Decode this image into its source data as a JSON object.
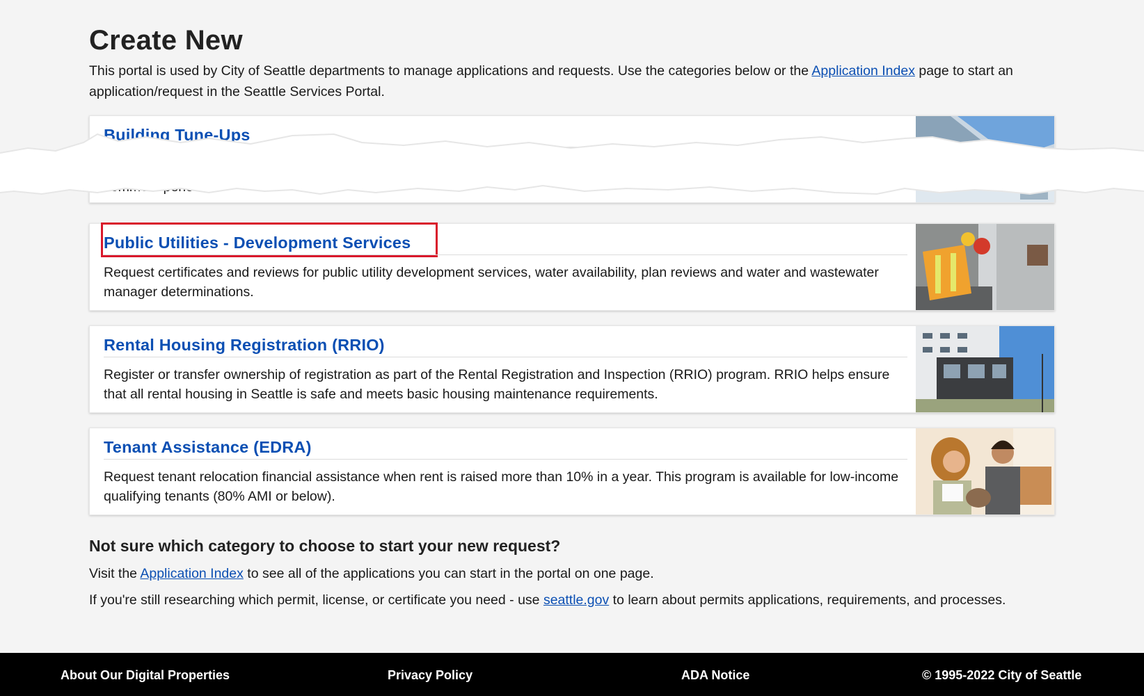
{
  "page": {
    "title": "Create New",
    "intro_before": "This portal is used by City of Seattle departments to manage applications and requests. Use the categories below or the ",
    "intro_link": "Application Index",
    "intro_after": " page to start an application/request in the Seattle Services Portal."
  },
  "cards": [
    {
      "title": "Building Tune-Ups",
      "description_partial": "Com",
      "description_end": "comment period.",
      "image_icon": "building-photo"
    },
    {
      "title": "Public Utilities - Development Services",
      "description": "Request certificates and reviews for public utility development services, water availability, plan reviews and water and wastewater manager determinations.",
      "image_icon": "utility-workers-photo",
      "highlighted": true,
      "highlight_color": "#d9182b"
    },
    {
      "title": "Rental Housing Registration (RRIO)",
      "description": "Register or transfer ownership of registration as part of the Rental Registration and Inspection (RRIO) program. RRIO helps ensure that all rental housing in Seattle is safe and meets basic housing maintenance requirements.",
      "image_icon": "apartment-building-photo"
    },
    {
      "title": "Tenant Assistance (EDRA)",
      "description": "Request tenant relocation financial assistance when rent is raised more than 10% in a year. This program is available for low-income qualifying tenants (80% AMI or below).",
      "image_icon": "tenants-photo"
    }
  ],
  "help": {
    "heading": "Not sure which category to choose to start your new request?",
    "line1_before": "Visit the ",
    "line1_link": "Application Index",
    "line1_after": " to see all of the applications you can start in the portal on one page.",
    "line2_before": "If you're still researching which permit, license, or certificate you need - use ",
    "line2_link": "seattle.gov",
    "line2_after": " to learn about permits applications, requirements, and processes."
  },
  "footer": {
    "about": "About Our Digital Properties",
    "privacy": "Privacy Policy",
    "ada": "ADA Notice",
    "copyright": "© 1995-2022 City of Seattle"
  },
  "colors": {
    "link": "#0b4fb3",
    "footer_bg": "#000000",
    "page_bg": "#f4f4f4"
  }
}
